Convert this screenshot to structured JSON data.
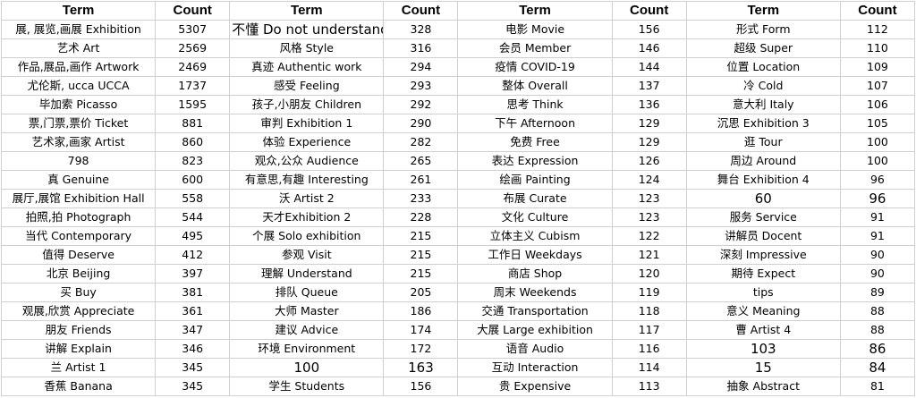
{
  "headers": [
    "Term",
    "Count",
    "Term",
    "Count",
    "Term",
    "Count",
    "Term",
    "Count"
  ],
  "rows": [
    [
      "展, 展览,画展 Exhibition",
      "5307",
      "不懂 Do not understand",
      "328",
      "电影 Movie",
      "156",
      "形式 Form",
      "112"
    ],
    [
      "艺术 Art",
      "2569",
      "风格 Style",
      "316",
      "会员 Member",
      "146",
      "超级 Super",
      "110"
    ],
    [
      "作品,展品,画作 Artwork",
      "2469",
      "真迹  Authentic work",
      "294",
      "疫情 COVID-19",
      "144",
      "位置 Location",
      "109"
    ],
    [
      "尤伦斯, ucca UCCA",
      "1737",
      "感受 Feeling",
      "293",
      "整体 Overall",
      "137",
      "冷 Cold",
      "107"
    ],
    [
      "毕加索 Picasso",
      "1595",
      "孩子,小朋友 Children",
      "292",
      "思考 Think",
      "136",
      "意大利 Italy",
      "106"
    ],
    [
      "票,门票,票价 Ticket",
      "881",
      "审判 Exhibition 1",
      "290",
      "下午 Afternoon",
      "129",
      "沉思 Exhibition 3",
      "105"
    ],
    [
      "艺术家,画家 Artist",
      "860",
      "体验 Experience",
      "282",
      "免费 Free",
      "129",
      "逛 Tour",
      "100"
    ],
    [
      "798",
      "823",
      "观众,公众 Audience",
      "265",
      "表达 Expression",
      "126",
      "周边 Around",
      "100"
    ],
    [
      "真 Genuine",
      "600",
      "有意思,有趣 Interesting",
      "261",
      "绘画 Painting",
      "124",
      "舞台 Exhibition 4",
      "96"
    ],
    [
      "展厅,展馆 Exhibition Hall",
      "558",
      "沃 Artist 2",
      "233",
      "布展 Curate",
      "123",
      "60",
      "96"
    ],
    [
      "拍照,拍 Photograph",
      "544",
      "天才Exhibition 2",
      "228",
      "文化 Culture",
      "123",
      "服务 Service",
      "91"
    ],
    [
      "当代 Contemporary",
      "495",
      "个展 Solo exhibition",
      "215",
      "立体主义 Cubism",
      "122",
      "讲解员 Docent",
      "91"
    ],
    [
      "值得 Deserve",
      "412",
      "参观 Visit",
      "215",
      "工作日 Weekdays",
      "121",
      "深刻 Impressive",
      "90"
    ],
    [
      "北京 Beijing",
      "397",
      "理解 Understand",
      "215",
      "商店 Shop",
      "120",
      "期待 Expect",
      "90"
    ],
    [
      "买 Buy",
      "381",
      "排队 Queue",
      "205",
      "周末 Weekends",
      "119",
      "tips",
      "89"
    ],
    [
      "观展,欣赏 Appreciate",
      "361",
      "大师 Master",
      "186",
      "交通 Transportation",
      "118",
      "意义 Meaning",
      "88"
    ],
    [
      "朋友 Friends",
      "347",
      "建议 Advice",
      "174",
      "大展 Large exhibition",
      "117",
      "曹 Artist 4",
      "88"
    ],
    [
      "讲解 Explain",
      "346",
      "环境 Environment",
      "172",
      "语音 Audio",
      "116",
      "103",
      "86"
    ],
    [
      "兰 Artist 1",
      "345",
      "100",
      "163",
      "互动 Interaction",
      "114",
      "15",
      "84"
    ],
    [
      "香蕉 Banana",
      "345",
      "学生 Students",
      "156",
      "贵 Expensive",
      "113",
      "抽象 Abstract",
      "81"
    ]
  ],
  "large_cells": [
    [
      0,
      2
    ],
    [
      9,
      6
    ],
    [
      9,
      7
    ],
    [
      17,
      6
    ],
    [
      17,
      7
    ],
    [
      18,
      2
    ],
    [
      18,
      3
    ],
    [
      18,
      6
    ],
    [
      18,
      7
    ]
  ]
}
